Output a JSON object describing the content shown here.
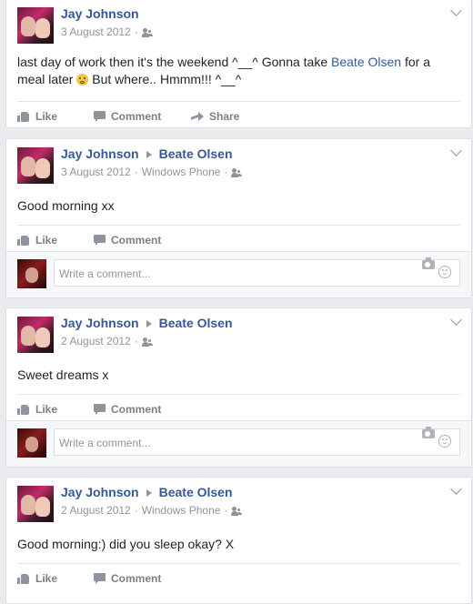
{
  "actions": {
    "like": "Like",
    "comment": "Comment",
    "share": "Share"
  },
  "comment_placeholder": "Write a comment...",
  "posts": [
    {
      "author": "Jay Johnson",
      "date": "3 August 2012",
      "text_before": "last day of work then it's the weekend ^__^ Gonna take ",
      "mention": "Beate Olsen",
      "text_after": " for a meal later",
      "text_end": " But where.. Hmmm!!! ^__^"
    },
    {
      "author": "Jay Johnson",
      "target": "Beate Olsen",
      "date": "3 August 2012",
      "via": "Windows Phone",
      "text": "Good morning xx"
    },
    {
      "author": "Jay Johnson",
      "target": "Beate Olsen",
      "date": "2 August 2012",
      "text": "Sweet dreams x"
    },
    {
      "author": "Jay Johnson",
      "target": "Beate Olsen",
      "date": "2 August 2012",
      "via": "Windows Phone",
      "text": "Good morning:) did you sleep okay? X"
    }
  ],
  "colors": {
    "link": "#365899",
    "meta": "#90949c",
    "background": "#e9ebee"
  }
}
